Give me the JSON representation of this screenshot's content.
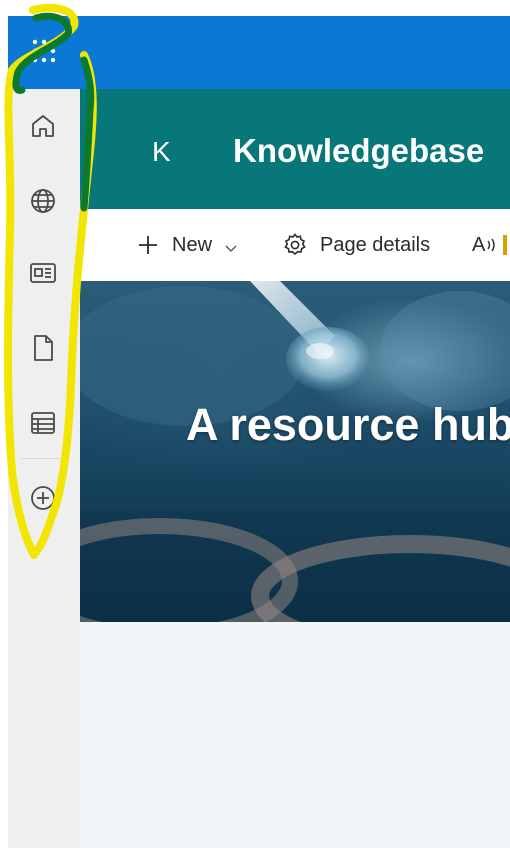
{
  "header": {
    "site_logo_letter": "K",
    "site_title": "Knowledgebase"
  },
  "command_bar": {
    "new_label": "New",
    "page_details_label": "Page details",
    "read_label": "A"
  },
  "app_bar": {
    "items": [
      {
        "icon": "home-icon"
      },
      {
        "icon": "globe-icon"
      },
      {
        "icon": "news-icon"
      },
      {
        "icon": "document-icon"
      },
      {
        "icon": "list-icon"
      },
      {
        "icon": "add-circle-icon"
      }
    ]
  },
  "hero": {
    "title": "A resource hub"
  },
  "colors": {
    "suite_bar": "#0a78d4",
    "site_header": "#07777a",
    "app_bar": "#efefef",
    "annotation_outer": "#f2e600",
    "annotation_inner": "#0b7a2e"
  }
}
